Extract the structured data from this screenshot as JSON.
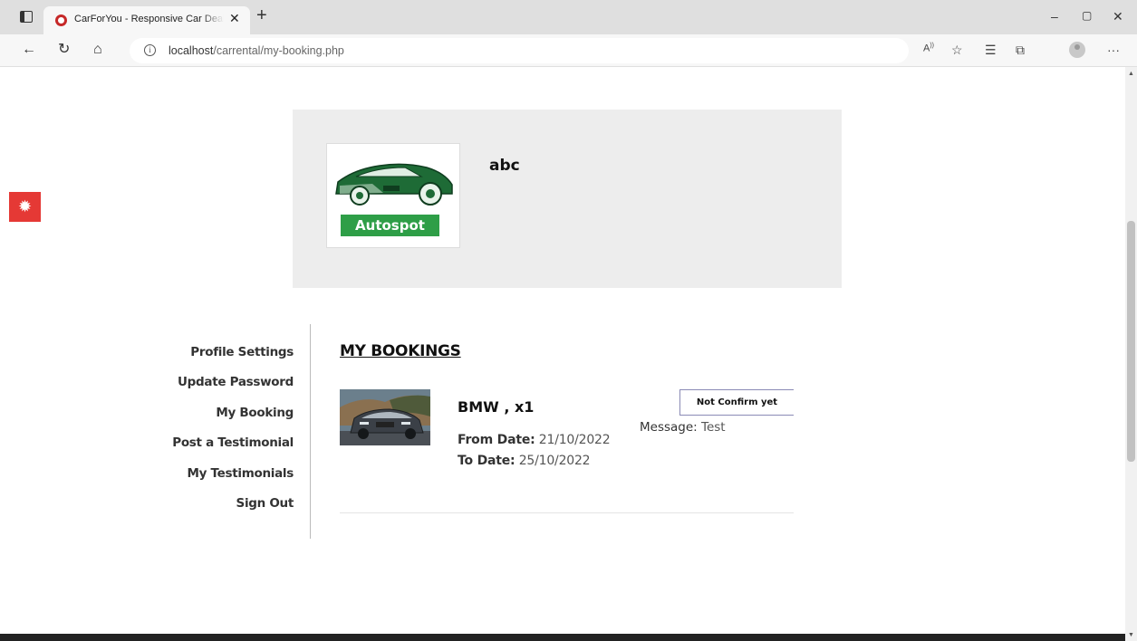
{
  "browser": {
    "tab_title": "CarForYou - Responsive Car Dealer",
    "tab_close": "✕",
    "new_tab": "+",
    "url_host": "localhost",
    "url_path": "/carrental/my-booking.php",
    "window_controls": [
      "–",
      "▢",
      "✕"
    ]
  },
  "profile": {
    "logo_text": "Autospot",
    "name": "abc"
  },
  "sidebar": {
    "items": [
      {
        "label": "Profile Settings"
      },
      {
        "label": "Update Password"
      },
      {
        "label": "My Booking"
      },
      {
        "label": "Post a Testimonial"
      },
      {
        "label": "My Testimonials"
      },
      {
        "label": "Sign Out"
      }
    ]
  },
  "bookings": {
    "title": "MY BOOKINGS",
    "items": [
      {
        "car": "BMW , x1",
        "from_label": "From Date:",
        "from_date": "21/10/2022",
        "to_label": "To Date:",
        "to_date": "25/10/2022",
        "status": "Not Confirm yet",
        "message_label": "Message:",
        "message": "Test"
      }
    ]
  },
  "colors": {
    "accent_red": "#e53935",
    "logo_green": "#2e9e47",
    "card_bg": "#ededed"
  },
  "icons": [
    "sidebar-toggle-icon",
    "back-icon",
    "refresh-icon",
    "home-icon",
    "info-icon",
    "read-aloud-icon",
    "favorite-icon",
    "favorites-list-icon",
    "collections-icon",
    "profile-icon",
    "more-icon",
    "gear-icon"
  ]
}
